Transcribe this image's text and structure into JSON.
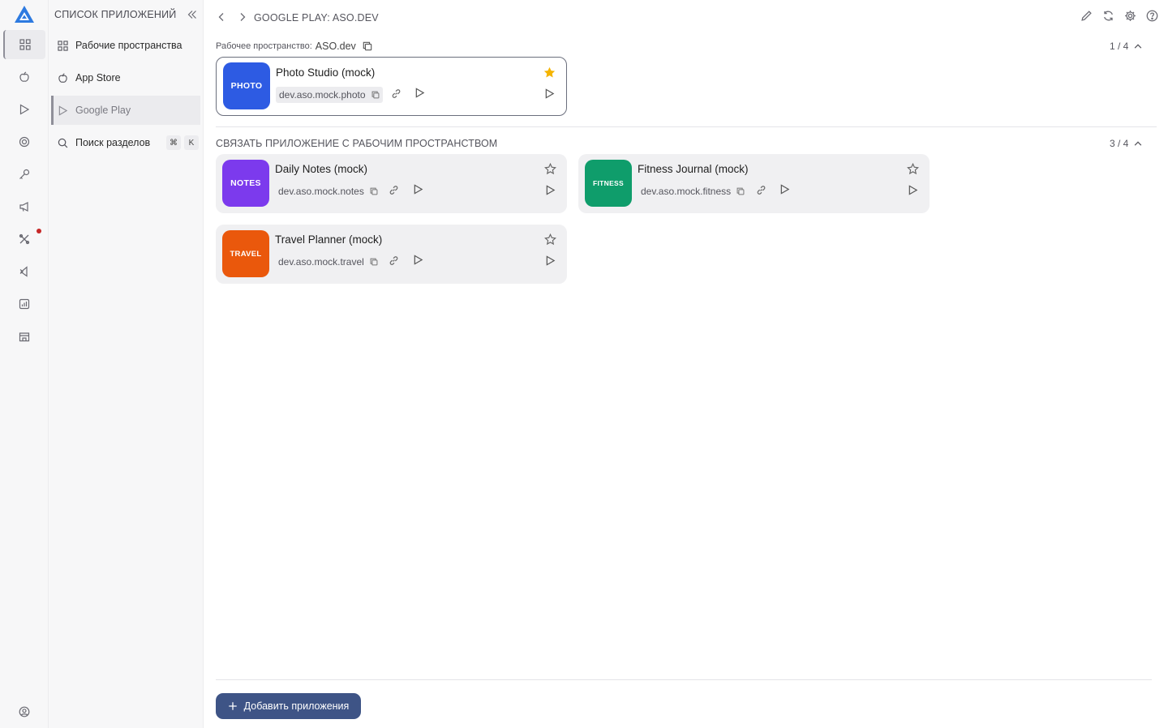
{
  "colors": {
    "accent": "#3e5486",
    "logo": "#2d7ae0",
    "star_active": "#f5b400",
    "notification_dot": "#c62828"
  },
  "rail": {
    "icons": [
      "logo-icon",
      "grid-icon",
      "apple-icon",
      "play-icon",
      "target-icon",
      "key-icon",
      "megaphone-icon",
      "tools-icon",
      "vscode-icon",
      "chart-icon",
      "store-icon",
      "user-icon"
    ]
  },
  "nav": {
    "header": "СПИСОК ПРИЛОЖЕНИЙ",
    "items": [
      {
        "label": "Рабочие пространства",
        "icon": "grid-icon"
      },
      {
        "label": "App Store",
        "icon": "apple-icon"
      },
      {
        "label": "Google Play",
        "icon": "play-icon",
        "active": true
      },
      {
        "label": "Поиск разделов",
        "icon": "search-icon",
        "shortcut": [
          "⌘",
          "K"
        ]
      }
    ]
  },
  "header": {
    "title": "GOOGLE PLAY: ASO.DEV",
    "tools": [
      "edit-icon",
      "refresh-icon",
      "settings-icon",
      "help-icon"
    ]
  },
  "workspace": {
    "label": "Рабочее пространство:",
    "name": "ASO.dev",
    "counter": "1 / 4",
    "apps": [
      {
        "icon_text": "PHOTO",
        "icon_color": "#2d5be3",
        "name": "Photo Studio (mock)",
        "package": "dev.aso.mock.photo",
        "starred": true
      }
    ]
  },
  "link_section": {
    "title": "СВЯЗАТЬ ПРИЛОЖЕНИЕ С РАБОЧИМ ПРОСТРАНСТВОМ",
    "counter": "3 / 4",
    "apps": [
      {
        "icon_text": "NOTES",
        "icon_color": "#7c3aed",
        "name": "Daily Notes (mock)",
        "package": "dev.aso.mock.notes",
        "starred": false
      },
      {
        "icon_text": "FITNESS",
        "icon_color": "#0f9d6b",
        "name": "Fitness Journal (mock)",
        "package": "dev.aso.mock.fitness",
        "starred": false
      },
      {
        "icon_text": "TRAVEL",
        "icon_color": "#ea580c",
        "name": "Travel Planner (mock)",
        "package": "dev.aso.mock.travel",
        "starred": false
      }
    ]
  },
  "footer": {
    "add_button": "Добавить приложения"
  }
}
